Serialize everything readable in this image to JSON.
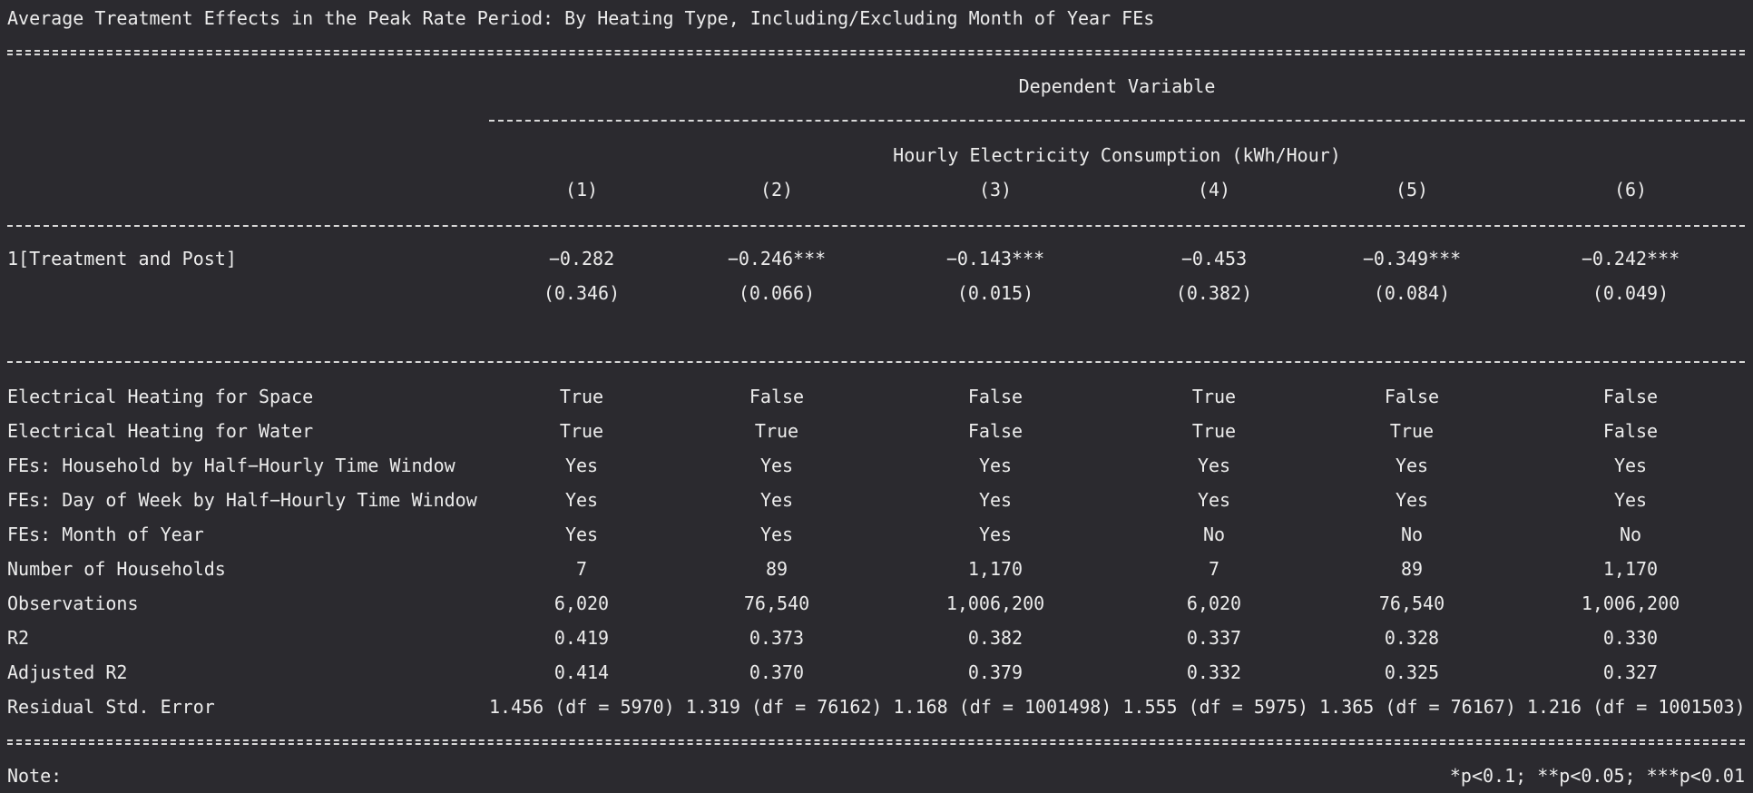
{
  "title": "Average Treatment Effects in the Peak Rate Period: By Heating Type, Including/Excluding Month of Year FEs",
  "header": {
    "dependent_variable": "Dependent Variable",
    "dependent_variable_name": "Hourly Electricity Consumption (kWh/Hour)",
    "columns": [
      "(1)",
      "(2)",
      "(3)",
      "(4)",
      "(5)",
      "(6)"
    ]
  },
  "coefficients": {
    "label": "1[Treatment and Post]",
    "estimates": [
      "−0.282",
      "−0.246***",
      "−0.143***",
      "−0.453",
      "−0.349***",
      "−0.242***"
    ],
    "std_errors": [
      "(0.346)",
      "(0.066)",
      "(0.015)",
      "(0.382)",
      "(0.084)",
      "(0.049)"
    ]
  },
  "stats": [
    {
      "label": "Electrical Heating for Space",
      "values": [
        "True",
        "False",
        "False",
        "True",
        "False",
        "False"
      ]
    },
    {
      "label": "Electrical Heating for Water",
      "values": [
        "True",
        "True",
        "False",
        "True",
        "True",
        "False"
      ]
    },
    {
      "label": "FEs: Household by Half−Hourly Time Window",
      "values": [
        "Yes",
        "Yes",
        "Yes",
        "Yes",
        "Yes",
        "Yes"
      ]
    },
    {
      "label": "FEs: Day of Week by Half−Hourly Time Window",
      "values": [
        "Yes",
        "Yes",
        "Yes",
        "Yes",
        "Yes",
        "Yes"
      ]
    },
    {
      "label": "FEs: Month of Year",
      "values": [
        "Yes",
        "Yes",
        "Yes",
        "No",
        "No",
        "No"
      ]
    },
    {
      "label": "Number of Households",
      "values": [
        "7",
        "89",
        "1,170",
        "7",
        "89",
        "1,170"
      ]
    },
    {
      "label": "Observations",
      "values": [
        "6,020",
        "76,540",
        "1,006,200",
        "6,020",
        "76,540",
        "1,006,200"
      ]
    },
    {
      "label": "R2",
      "values": [
        "0.419",
        "0.373",
        "0.382",
        "0.337",
        "0.328",
        "0.330"
      ]
    },
    {
      "label": "Adjusted R2",
      "values": [
        "0.414",
        "0.370",
        "0.379",
        "0.332",
        "0.325",
        "0.327"
      ]
    }
  ],
  "residual": {
    "label": "Residual Std. Error",
    "text": "1.456 (df = 5970) 1.319 (df = 76162) 1.168 (df = 1001498) 1.555 (df = 5975) 1.365 (df = 76167) 1.216 (df = 1001503)"
  },
  "note": {
    "label": "Note:",
    "text": "*p<0.1; **p<0.05; ***p<0.01"
  }
}
